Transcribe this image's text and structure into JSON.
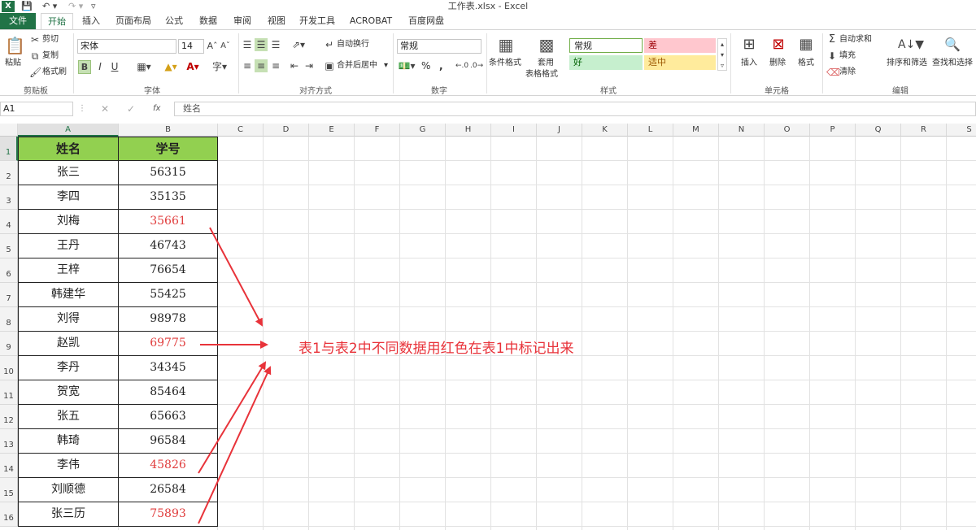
{
  "window": {
    "title": "工作表.xlsx - Excel"
  },
  "tabs": [
    "文件",
    "开始",
    "插入",
    "页面布局",
    "公式",
    "数据",
    "审阅",
    "视图",
    "开发工具",
    "ACROBAT",
    "百度网盘"
  ],
  "ribbon": {
    "clipboard": {
      "paste": "粘贴",
      "cut": "剪切",
      "copy": "复制",
      "format_painter": "格式刷",
      "label": "剪贴板"
    },
    "font": {
      "name": "宋体",
      "size": "14",
      "bold": "B",
      "italic": "I",
      "underline": "U",
      "label": "字体"
    },
    "alignment": {
      "wrap": "自动换行",
      "merge": "合并后居中",
      "label": "对齐方式"
    },
    "number": {
      "format": "常规",
      "percent": "%",
      "comma": ",",
      "label": "数字"
    },
    "styles": {
      "conditional": "条件格式",
      "table_line1": "套用",
      "table_line2": "表格格式",
      "normal": "常规",
      "bad": "差",
      "good": "好",
      "neutral": "适中",
      "label": "样式"
    },
    "cells": {
      "insert": "插入",
      "delete": "删除",
      "format": "格式",
      "label": "单元格"
    },
    "editing": {
      "autosum": "自动求和",
      "fill": "填充",
      "clear": "清除",
      "sort": "排序和筛选",
      "find": "查找和选择",
      "label": "编辑"
    }
  },
  "formula_bar": {
    "name_box": "A1",
    "fx": "fx",
    "content": "姓名"
  },
  "columns": [
    "A",
    "B",
    "C",
    "D",
    "E",
    "F",
    "G",
    "H",
    "I",
    "J",
    "K",
    "L",
    "M",
    "N",
    "O",
    "P",
    "Q",
    "R",
    "S"
  ],
  "rows": [
    "1",
    "2",
    "3",
    "4",
    "5",
    "6",
    "7",
    "8",
    "9",
    "10",
    "11",
    "12",
    "13",
    "14",
    "15",
    "16"
  ],
  "table": {
    "headers": [
      "姓名",
      "学号"
    ],
    "rows": [
      {
        "name": "张三",
        "id": "56315",
        "red": false
      },
      {
        "name": "李四",
        "id": "35135",
        "red": false
      },
      {
        "name": "刘梅",
        "id": "35661",
        "red": true
      },
      {
        "name": "王丹",
        "id": "46743",
        "red": false
      },
      {
        "name": "王梓",
        "id": "76654",
        "red": false
      },
      {
        "name": "韩建华",
        "id": "55425",
        "red": false
      },
      {
        "name": "刘得",
        "id": "98978",
        "red": false
      },
      {
        "name": "赵凯",
        "id": "69775",
        "red": true
      },
      {
        "name": "李丹",
        "id": "34345",
        "red": false
      },
      {
        "name": "贺宽",
        "id": "85464",
        "red": false
      },
      {
        "name": "张五",
        "id": "65663",
        "red": false
      },
      {
        "name": "韩琦",
        "id": "96584",
        "red": false
      },
      {
        "name": "李伟",
        "id": "45826",
        "red": true
      },
      {
        "name": "刘顺德",
        "id": "26584",
        "red": false
      },
      {
        "name": "张三历",
        "id": "75893",
        "red": true
      }
    ]
  },
  "annotation": "表1与表2中不同数据用红色在表1中标记出来",
  "colors": {
    "excel_green": "#217346",
    "header_fill": "#92d050",
    "highlight_red": "#e03c3c",
    "arrow_red": "#e8333a"
  }
}
